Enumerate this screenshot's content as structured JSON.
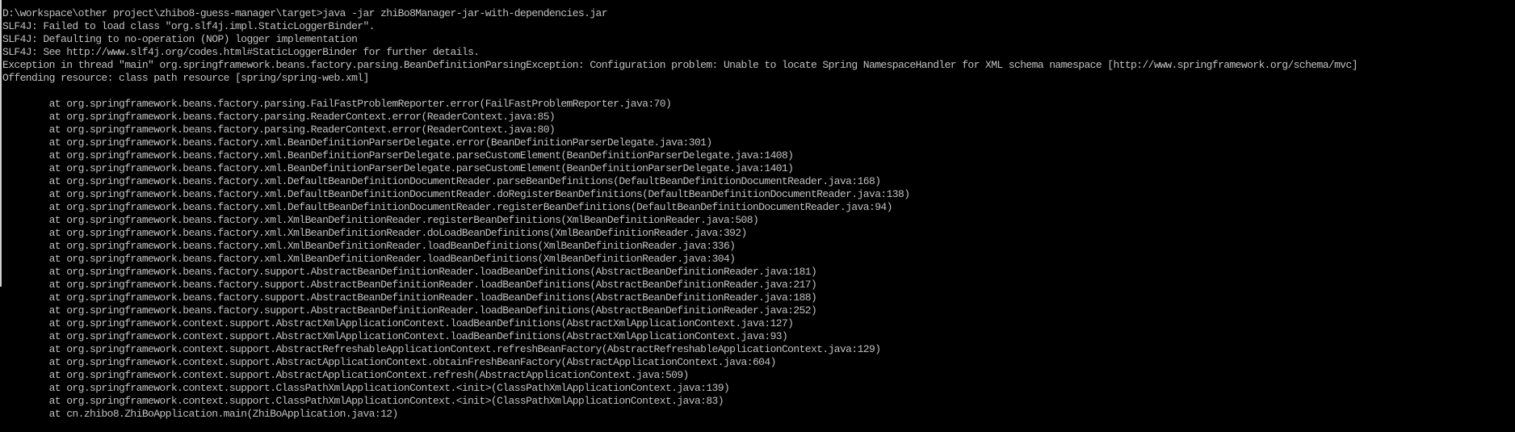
{
  "terminal": {
    "colors": {
      "background": "#000000",
      "text": "#c0c0c0"
    },
    "lines": [
      "D:\\workspace\\other project\\zhibo8-guess-manager\\target>java -jar zhiBo8Manager-jar-with-dependencies.jar",
      "SLF4J: Failed to load class \"org.slf4j.impl.StaticLoggerBinder\".",
      "SLF4J: Defaulting to no-operation (NOP) logger implementation",
      "SLF4J: See http://www.slf4j.org/codes.html#StaticLoggerBinder for further details.",
      "Exception in thread \"main\" org.springframework.beans.factory.parsing.BeanDefinitionParsingException: Configuration problem: Unable to locate Spring NamespaceHandler for XML schema namespace [http://www.springframework.org/schema/mvc]",
      "Offending resource: class path resource [spring/spring-web.xml]",
      "",
      "        at org.springframework.beans.factory.parsing.FailFastProblemReporter.error(FailFastProblemReporter.java:70)",
      "        at org.springframework.beans.factory.parsing.ReaderContext.error(ReaderContext.java:85)",
      "        at org.springframework.beans.factory.parsing.ReaderContext.error(ReaderContext.java:80)",
      "        at org.springframework.beans.factory.xml.BeanDefinitionParserDelegate.error(BeanDefinitionParserDelegate.java:301)",
      "        at org.springframework.beans.factory.xml.BeanDefinitionParserDelegate.parseCustomElement(BeanDefinitionParserDelegate.java:1408)",
      "        at org.springframework.beans.factory.xml.BeanDefinitionParserDelegate.parseCustomElement(BeanDefinitionParserDelegate.java:1401)",
      "        at org.springframework.beans.factory.xml.DefaultBeanDefinitionDocumentReader.parseBeanDefinitions(DefaultBeanDefinitionDocumentReader.java:168)",
      "        at org.springframework.beans.factory.xml.DefaultBeanDefinitionDocumentReader.doRegisterBeanDefinitions(DefaultBeanDefinitionDocumentReader.java:138)",
      "        at org.springframework.beans.factory.xml.DefaultBeanDefinitionDocumentReader.registerBeanDefinitions(DefaultBeanDefinitionDocumentReader.java:94)",
      "        at org.springframework.beans.factory.xml.XmlBeanDefinitionReader.registerBeanDefinitions(XmlBeanDefinitionReader.java:508)",
      "        at org.springframework.beans.factory.xml.XmlBeanDefinitionReader.doLoadBeanDefinitions(XmlBeanDefinitionReader.java:392)",
      "        at org.springframework.beans.factory.xml.XmlBeanDefinitionReader.loadBeanDefinitions(XmlBeanDefinitionReader.java:336)",
      "        at org.springframework.beans.factory.xml.XmlBeanDefinitionReader.loadBeanDefinitions(XmlBeanDefinitionReader.java:304)",
      "        at org.springframework.beans.factory.support.AbstractBeanDefinitionReader.loadBeanDefinitions(AbstractBeanDefinitionReader.java:181)",
      "        at org.springframework.beans.factory.support.AbstractBeanDefinitionReader.loadBeanDefinitions(AbstractBeanDefinitionReader.java:217)",
      "        at org.springframework.beans.factory.support.AbstractBeanDefinitionReader.loadBeanDefinitions(AbstractBeanDefinitionReader.java:188)",
      "        at org.springframework.beans.factory.support.AbstractBeanDefinitionReader.loadBeanDefinitions(AbstractBeanDefinitionReader.java:252)",
      "        at org.springframework.context.support.AbstractXmlApplicationContext.loadBeanDefinitions(AbstractXmlApplicationContext.java:127)",
      "        at org.springframework.context.support.AbstractXmlApplicationContext.loadBeanDefinitions(AbstractXmlApplicationContext.java:93)",
      "        at org.springframework.context.support.AbstractRefreshableApplicationContext.refreshBeanFactory(AbstractRefreshableApplicationContext.java:129)",
      "        at org.springframework.context.support.AbstractApplicationContext.obtainFreshBeanFactory(AbstractApplicationContext.java:604)",
      "        at org.springframework.context.support.AbstractApplicationContext.refresh(AbstractApplicationContext.java:509)",
      "        at org.springframework.context.support.ClassPathXmlApplicationContext.<init>(ClassPathXmlApplicationContext.java:139)",
      "        at org.springframework.context.support.ClassPathXmlApplicationContext.<init>(ClassPathXmlApplicationContext.java:83)",
      "        at cn.zhibo8.ZhiBoApplication.main(ZhiBoApplication.java:12)"
    ]
  }
}
